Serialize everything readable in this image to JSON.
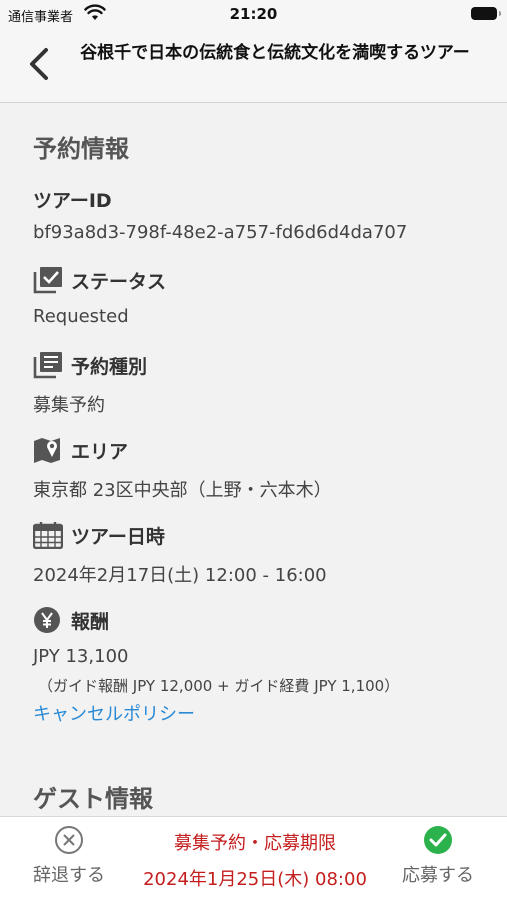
{
  "status_bar": {
    "carrier": "通信事業者",
    "time": "21:20"
  },
  "nav": {
    "title": "谷根千で日本の伝統食と伝統文化を満喫するツアー"
  },
  "reservation": {
    "section_title": "予約情報",
    "tour_id_label": "ツアーID",
    "tour_id": "bf93a8d3-798f-48e2-a757-fd6d6d4da707",
    "status_label": "ステータス",
    "status_value": "Requested",
    "type_label": "予約種別",
    "type_value": "募集予約",
    "area_label": "エリア",
    "area_value": "東京都 23区中央部（上野・六本木）",
    "datetime_label": "ツアー日時",
    "datetime_value": "2024年2月17日(土) 12:00 - 16:00",
    "fee_label": "報酬",
    "fee_value": "JPY 13,100",
    "fee_detail": "（ガイド報酬 JPY 12,000 + ガイド経費 JPY 1,100）",
    "cancel_policy_link": "キャンセルポリシー"
  },
  "guest": {
    "section_title": "ゲスト情報"
  },
  "bottom": {
    "decline_label": "辞退する",
    "apply_label": "応募する",
    "deadline_title": "募集予約・応募期限",
    "deadline_value": "2024年1月25日(木) 08:00"
  },
  "colors": {
    "accent_link": "#2a8ad6",
    "deadline_red": "#c41e1e",
    "apply_green": "#2bb24c"
  },
  "icons": [
    "wifi-icon",
    "battery-icon",
    "back-chevron-icon",
    "status-check-icon",
    "list-icon",
    "map-icon",
    "calendar-icon",
    "yen-icon",
    "decline-icon",
    "apply-icon"
  ]
}
